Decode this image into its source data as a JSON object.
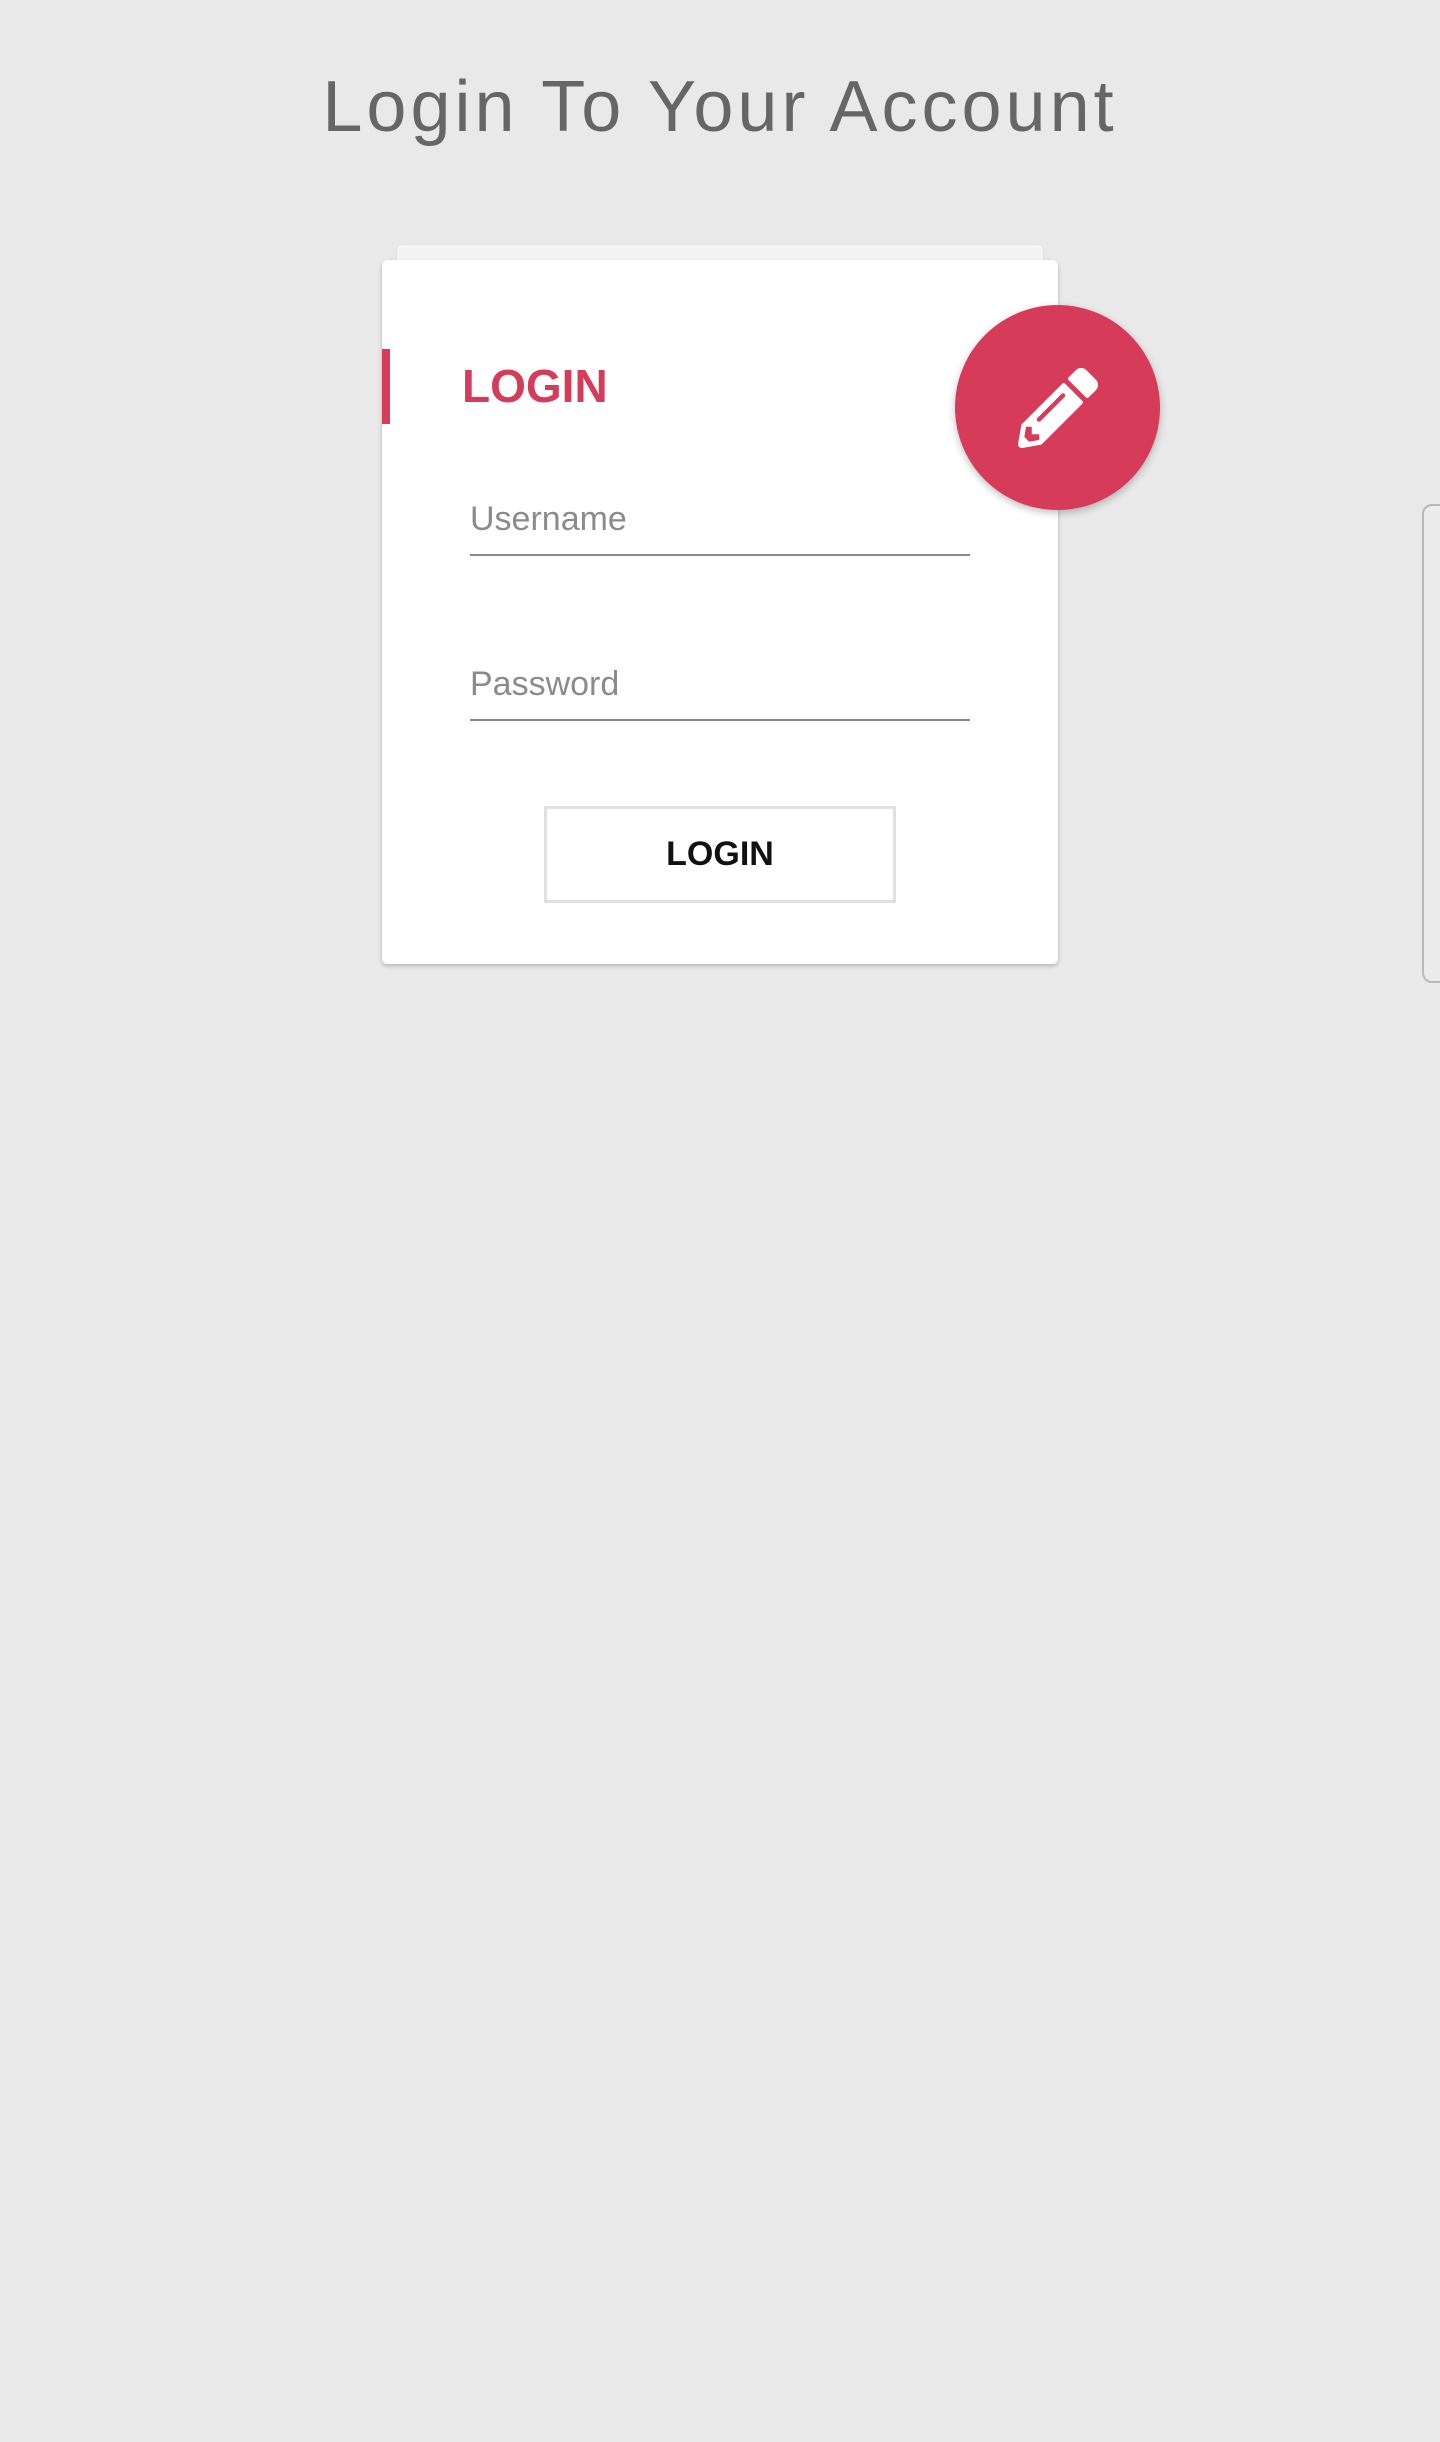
{
  "page": {
    "title": "Login To Your Account"
  },
  "login_card": {
    "heading": "LOGIN",
    "username": {
      "placeholder": "Username",
      "value": ""
    },
    "password": {
      "placeholder": "Password",
      "value": ""
    },
    "submit_label": "LOGIN"
  },
  "fab": {
    "icon": "pencil-icon"
  },
  "colors": {
    "background": "#e9e9e9",
    "accent": "#d63c5a",
    "card": "#ffffff",
    "title_text": "#666666"
  }
}
